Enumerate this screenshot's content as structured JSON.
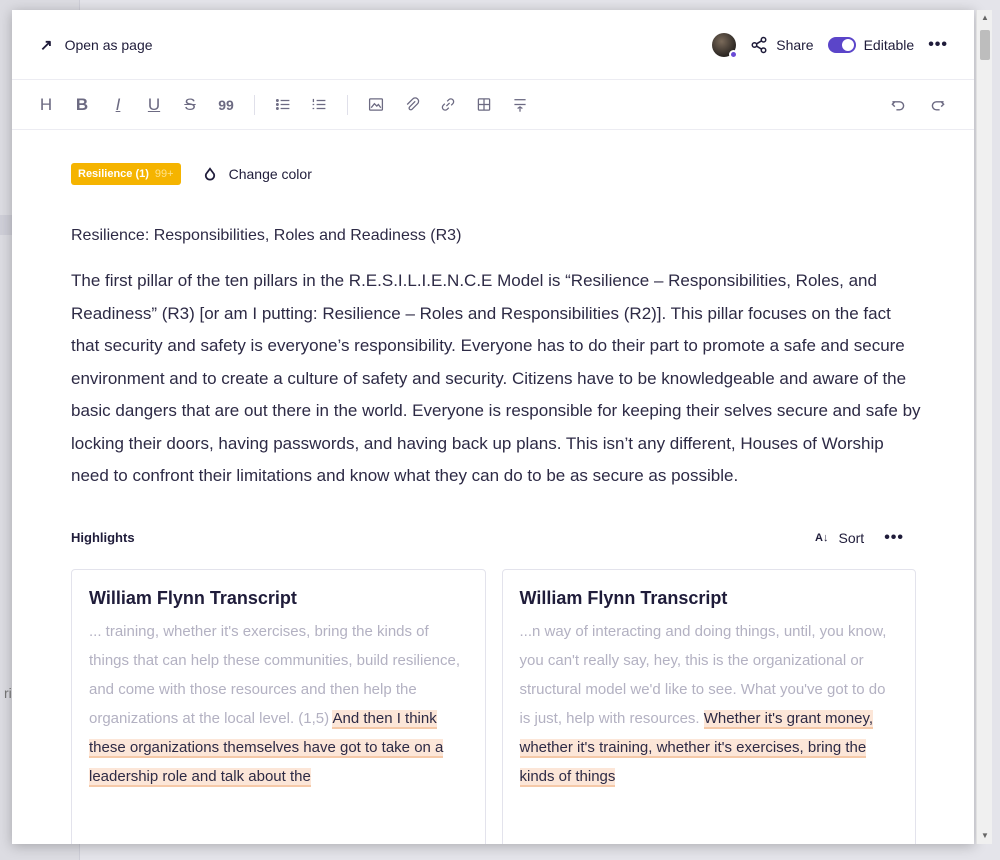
{
  "background": {
    "left_letter": "ri"
  },
  "header": {
    "open_as_page": "Open as page",
    "share": "Share",
    "editable": "Editable",
    "more": "•••"
  },
  "toolbar": {
    "heading": "H",
    "bold": "B",
    "italic": "I",
    "underline": "U",
    "strikethrough": "S",
    "quote": "99"
  },
  "tag": {
    "label": "Resilience (1)",
    "count": "99+",
    "color": "#f5b400"
  },
  "change_color": "Change color",
  "title": "Resilience: Responsibilities, Roles and Readiness (R3)",
  "paragraph": "The first pillar of the ten pillars in the R.E.S.I.L.I.E.N.C.E Model is “Resilience – Responsibilities, Roles, and Readiness” (R3) [or am I putting: Resilience – Roles and Responsibilities (R2)]. This pillar focuses on the fact that security and safety is everyone’s responsibility. Everyone has to do their part to promote a safe and secure environment and to create a culture of safety and security. Citizens have to be knowledgeable and aware of the basic dangers that are out there in the world. Everyone is responsible for keeping their selves secure and safe by locking their doors, having passwords, and having back up plans. This isn’t any different, Houses of Worship need to confront their limitations and know what they can do to be as secure as possible.",
  "highlights": {
    "label": "Highlights",
    "sort": "Sort",
    "sort_icon": "A-Z",
    "more": "•••",
    "cards": [
      {
        "title": "William Flynn Transcript",
        "context": "... training, whether it's exercises, bring the kinds of things that can help these communities, build resilience, and come with those resources and then help the organizations at the local level. (1,5) ",
        "highlight": "And then I think these organizations themselves have got to take on a leadership role and talk about the"
      },
      {
        "title": "William Flynn Transcript",
        "context": "...n way of interacting and doing things, until, you know, you can't really say, hey, this is the organizational or structural model we'd like to see. What you've got to do is just, help with resources. ",
        "highlight": "Whether it's grant money, whether it's training, whether it's exercises, bring the kinds of things"
      }
    ]
  },
  "colors": {
    "accent": "#5b45c9",
    "highlight_bg": "#fce6d8"
  }
}
